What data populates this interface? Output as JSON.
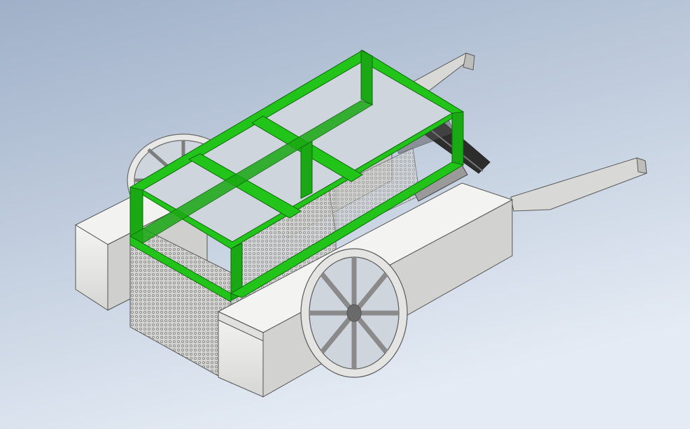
{
  "viewport": {
    "background_top": "#9fb0c8",
    "background_bottom": "#e4ebf4"
  },
  "colors": {
    "frame_green": "#22c41a",
    "frame_green_dark": "#118a10",
    "frame_green_light": "#52e04a",
    "body_light": "#efefed",
    "body_mid": "#d8d8d6",
    "body_dark": "#b8b8b6",
    "edge": "#555555",
    "mesh": "#9a9a9a",
    "metal_dark": "#3a3a3a",
    "rod": "#8c8c8c"
  },
  "parts": [
    "chassis-frame",
    "left-pontoon",
    "right-pontoon",
    "center-box",
    "mesh-screen",
    "front-wheel",
    "rear-wheel",
    "tow-arm-upper",
    "tow-arm-lower",
    "actuator",
    "conveyor-belt"
  ]
}
